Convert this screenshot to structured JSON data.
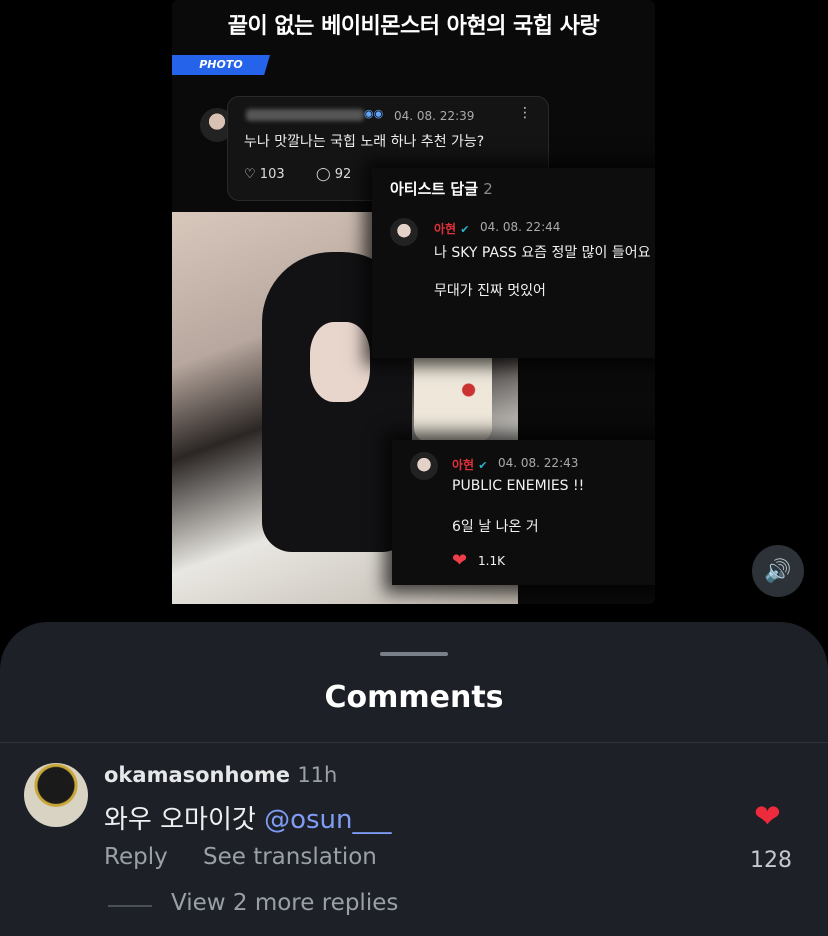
{
  "video": {
    "headline": "끝이 없는 베이비몬스터 아현의 국힙 사랑",
    "photo_tag": "PHOTO",
    "fan_comment": {
      "time": "04. 08. 22:39",
      "text": "누나 맛깔나는 국힙 노래 하나 추천 가능?",
      "likes": "103",
      "replies": "92"
    },
    "artist_panel": {
      "title": "아티스트 답글",
      "count": "2"
    },
    "artist_reply_1": {
      "name": "아현",
      "time": "04. 08. 22:44",
      "line1": "나 SKY PASS 요즘 정말 많이 들어요",
      "line2": "무대가 진짜 멋있어"
    },
    "artist_reply_2": {
      "name": "아현",
      "time": "04. 08. 22:43",
      "line1": "PUBLIC ENEMIES !!",
      "line2": "6일 날 나온 거",
      "likes": "1.1K"
    }
  },
  "sheet": {
    "title": "Comments",
    "comment": {
      "username": "okamasonhome",
      "time": "11h",
      "text": "와우 오마이갓",
      "mention": "@osun___",
      "reply_label": "Reply",
      "translate_label": "See translation",
      "likes": "128"
    },
    "view_more": "View 2 more replies"
  },
  "colors": {
    "sheet_bg": "#1d2127",
    "heart": "#ee2a3d",
    "mention": "#7f9cf5",
    "photo_tag": "#2563eb"
  }
}
